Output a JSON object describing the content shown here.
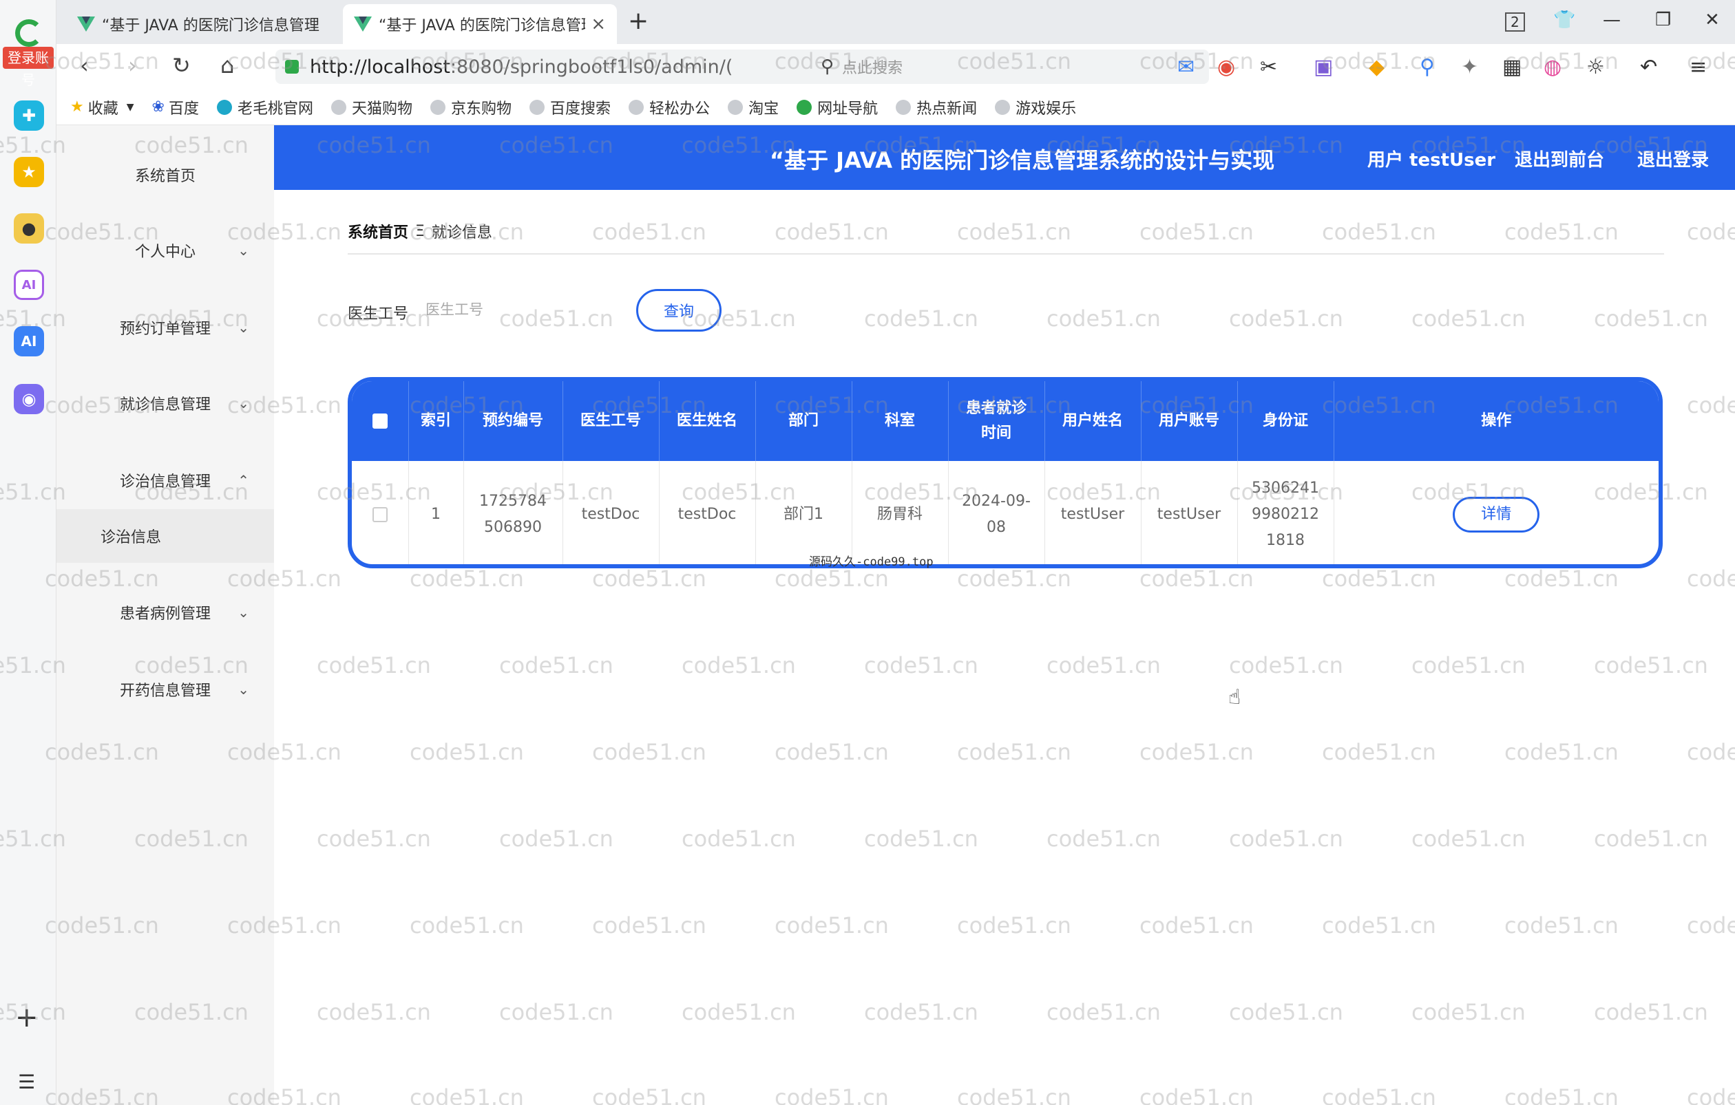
{
  "browser": {
    "rail_badge": "登录账号",
    "tabs": [
      {
        "label": "“基于 JAVA 的医院门诊信息管理"
      },
      {
        "label": "“基于 JAVA 的医院门诊信息管理"
      }
    ],
    "tab_close_symbol": "×",
    "new_tab_symbol": "+",
    "tab_count_badge": "2",
    "url_host": "http://localhost",
    "url_rest": ":8080/springbootf1ls0/admin/(",
    "search_placeholder": "点此搜索",
    "bookmarks": [
      "收藏",
      "百度",
      "老毛桃官网",
      "天猫购物",
      "京东购物",
      "百度搜索",
      "轻松办公",
      "淘宝",
      "网址导航",
      "热点新闻",
      "游戏娱乐"
    ]
  },
  "header": {
    "title": "“基于 JAVA 的医院门诊信息管理系统的设计与实现",
    "user_label": "用户 testUser",
    "to_front_label": "退出到前台",
    "logout_label": "退出登录"
  },
  "sidebar": {
    "items": [
      {
        "label": "系统首页"
      },
      {
        "label": "个人中心"
      },
      {
        "label": "预约订单管理"
      },
      {
        "label": "就诊信息管理"
      },
      {
        "label": "诊治信息管理"
      },
      {
        "label": "患者病例管理"
      },
      {
        "label": "开药信息管理"
      }
    ],
    "submenu_active": "诊治信息"
  },
  "breadcrumb": {
    "home": "系统首页",
    "separator": "Ξ",
    "current": "就诊信息"
  },
  "search": {
    "label": "医生工号",
    "placeholder": "医生工号",
    "button": "查询"
  },
  "table": {
    "columns": [
      "索引",
      "预约编号",
      "医生工号",
      "医生姓名",
      "部门",
      "科室",
      "患者就诊时间",
      "用户姓名",
      "用户账号",
      "身份证",
      "操作"
    ],
    "rows": [
      {
        "index": "1",
        "appointment_no": "1725784506890",
        "doctor_id": "testDoc",
        "doctor_name": "testDoc",
        "department": "部门1",
        "section": "肠胃科",
        "visit_time": "2024-09-08",
        "user_name": "testUser",
        "user_account": "testUser",
        "id_card": "530624199802121818",
        "action": "详情"
      }
    ]
  },
  "source_note": "源码久久-code99.top",
  "watermark": "code51.cn",
  "colors": {
    "primary": "#2563eb",
    "sidebar_bg": "#f5f5f5"
  }
}
